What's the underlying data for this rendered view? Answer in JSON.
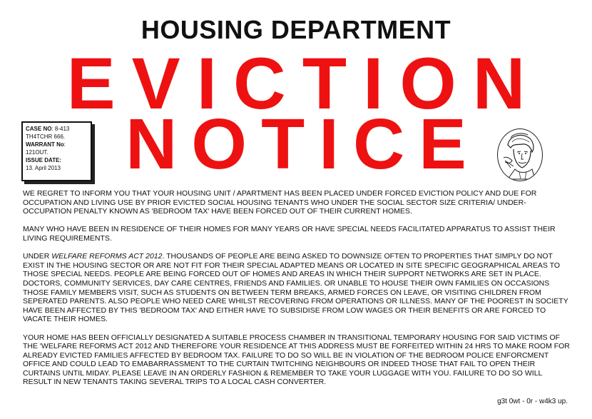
{
  "header": "HOUSING DEPARTMENT",
  "title_line1": "EVICTION",
  "title_line2": "NOTICE",
  "case_box": {
    "case_no_label": "CASE NO",
    "case_no_value": ": 8-413",
    "case_no_line2": "TH4TCHR 666.",
    "warrant_label": "WARRANT No",
    "warrant_sep": ":",
    "warrant_value": "121OUT.",
    "issue_label": "ISSUE DATE:",
    "issue_value": "13. April 2013"
  },
  "paragraphs": {
    "p1": "WE REGRET TO INFORM YOU THAT YOUR  HOUSING UNIT / APARTMENT HAS BEEN PLACED UNDER FORCED EVICTION POLICY AND DUE FOR OCCUPATION AND LIVING USE BY PRIOR EVICTED SOCIAL HOUSING TENANTS WHO UNDER THE SOCIAL SECTOR SIZE CRITERIA/ UNDER-OCCUPATION PENALTY KNOWN AS 'BEDROOM TAX' HAVE BEEN FORCED OUT OF THEIR CURRENT HOMES.",
    "p2": "MANY WHO HAVE BEEN IN RESIDENCE OF THEIR HOMES FOR MANY YEARS OR HAVE SPECIAL NEEDS FACILITATED APPARATUS TO ASSIST THEIR LIVING REQUIREMENTS.",
    "p3_prefix": "UNDER ",
    "p3_italic": "WELFARE REFORMS ACT 2012",
    "p3_rest": ". THOUSANDS OF PEOPLE ARE BEING ASKED TO DOWNSIZE OFTEN TO PROPERTIES THAT SIMPLY DO NOT EXIST IN THE HOUSING SECTOR OR ARE NOT FIT FOR THEIR SPECIAL ADAPTED MEANS OR LOCATED IN SITE SPECIFIC GEOGRAPHICAL AREAS TO THOSE SPECIAL NEEDS. PEOPLE ARE BEING FORCED OUT OF HOMES AND AREAS IN WHICH THEIR SUPPORT NETWORKS ARE SET IN PLACE. DOCTORS, COMMUNITY SERVICES, DAY CARE CENTRES, FRIENDS AND FAMILIES. OR UNABLE TO HOUSE THEIR OWN FAMILIES ON OCCASIONS THOSE FAMILY MEMBERS VISIT, SUCH AS STUDENTS ON BETWEEN TERM BREAKS, ARMED FORCES ON LEAVE, OR VISITING CHILDREN  FROM SEPERATED PARENTS. ALSO PEOPLE WHO NEED CARE WHILST RECOVERING FROM OPERATIONS OR ILLNESS. MANY OF THE POOREST IN SOCIETY HAVE BEEN AFFECTED BY THIS 'BEDROOM TAX' AND EITHER HAVE TO SUBSIDISE FROM LOW WAGES OR THEIR BENEFITS OR ARE FORCED TO VACATE THEIR HOMES.",
    "p4": "YOUR HOME HAS BEEN OFFICIALLY DESIGNATED A SUITABLE PROCESS CHAMBER IN TRANSITIONAL TEMPORARY HOUSING FOR SAID VICTIMS OF THE 'WELFARE REFORMS ACT 2012 AND THEREFORE YOUR RESIDENCE AT THIS ADDRESS MUST BE FORFEITED WITHIN 24 HRS TO MAKE ROOM FOR ALREADY EVICTED FAMILIES AFFECTED BY BEDROOM TAX. FAILURE TO DO SO WILL BE IN VIOLATION OF THE BEDROOM POLICE ENFORCMENT OFFICE AND COULD LEAD TO EMABARRASSMENT TO THE CURTAIN TWITCHING NEIGHBOURS OR INDEED THOSE THAT FAIL TO OPEN THEIR CURTAINS UNTIL MIDAY. PLEASE LEAVE IN AN ORDERLY FASHION & REMEMBER TO TAKE YOUR LUGGAGE WITH YOU. FAILURE TO DO SO WILL RESULT IN NEW TENANTS TAKING SEVERAL TRIPS TO A LOCAL CASH CONVERTER."
  },
  "signoff": "g3t 0wt - 0r - w4k3 up.",
  "colors": {
    "title_red": "#ee1111",
    "text": "#111111",
    "background": "#ffffff"
  },
  "portrait_icon": "sketched-portrait-seal"
}
